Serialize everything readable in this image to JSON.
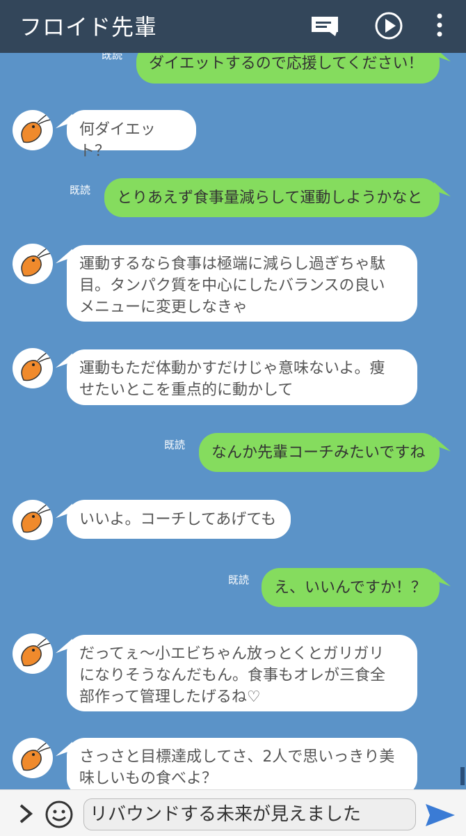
{
  "header": {
    "title": "フロイド先輩"
  },
  "messages": [
    {
      "side": "right",
      "read": "既読",
      "lines": [
        "ダイエットするので応援してください！"
      ]
    },
    {
      "side": "left",
      "lines": [
        "何ダイエット？"
      ]
    },
    {
      "side": "right",
      "read": "既読",
      "lines": [
        "とりあえず食事量減らして運動しようかなと"
      ]
    },
    {
      "side": "left",
      "lines": [
        "運動するなら食事は極端に減らし過ぎちゃ駄",
        "目。タンパク質を中心にしたバランスの良い",
        "メニューに変更しなきゃ"
      ]
    },
    {
      "side": "left",
      "lines": [
        "運動もただ体動かすだけじゃ意味ないよ。痩",
        "せたいとこを重点的に動かして"
      ]
    },
    {
      "side": "right",
      "read": "既読",
      "lines": [
        "なんか先輩コーチみたいですね"
      ]
    },
    {
      "side": "left",
      "lines": [
        "いいよ。コーチしてあげても"
      ]
    },
    {
      "side": "right",
      "read": "既読",
      "lines": [
        "え、いいんですか！？"
      ]
    },
    {
      "side": "left",
      "lines": [
        "だってぇ〜小エビちゃん放っとくとガリガリ",
        "になりそうなんだもん。食事もオレが三食全",
        "部作って管理したげるね♡"
      ]
    },
    {
      "side": "left",
      "lines": [
        "さっさと目標達成してさ、2人で思いっきり美",
        "味しいもの食べよ？"
      ]
    }
  ],
  "composer": {
    "text": "リバウンドする未来が見えました"
  },
  "colors": {
    "background": "#5b93c8",
    "header": "#33465a",
    "sent_bubble": "#85dc5e",
    "received_bubble": "#ffffff"
  }
}
